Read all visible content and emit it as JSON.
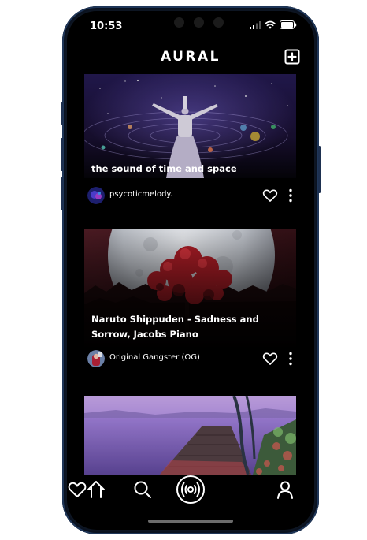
{
  "status_bar": {
    "time": "10:53"
  },
  "header": {
    "title": "AURAL",
    "add_icon": "plus-square-icon"
  },
  "feed": {
    "tracks": [
      {
        "title": "the sound of time and space",
        "author": "psycoticmelody."
      },
      {
        "title": "Naruto Shippuden - Sadness and Sorrow, Jacobs Piano",
        "author": "Original Gangster (OG)"
      }
    ]
  },
  "bottom_nav": {
    "items": [
      "home-icon",
      "search-icon",
      "broadcast-icon",
      "heart-icon",
      "profile-icon"
    ]
  },
  "colors": {
    "background": "#000000",
    "text": "#ffffff",
    "frame": "#0d1522"
  }
}
